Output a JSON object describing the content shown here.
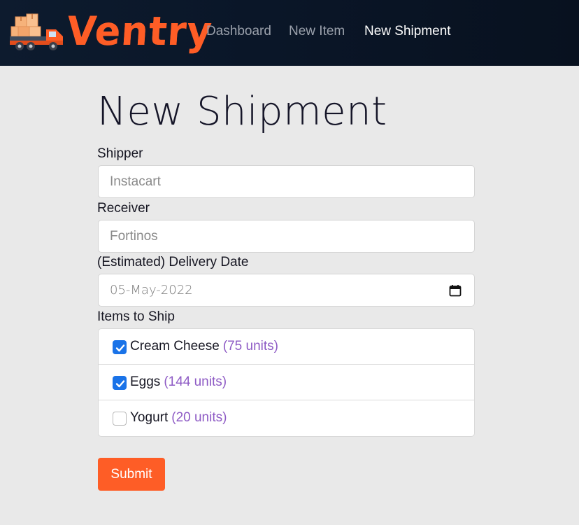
{
  "brand": {
    "name": "Ventry",
    "color": "#fe5d26"
  },
  "nav": {
    "items": [
      {
        "label": "Dashboard",
        "active": false
      },
      {
        "label": "New Item",
        "active": false
      },
      {
        "label": "New Shipment",
        "active": true
      }
    ]
  },
  "form": {
    "title": "New Shipment",
    "shipper": {
      "label": "Shipper",
      "placeholder": "Instacart"
    },
    "receiver": {
      "label": "Receiver",
      "placeholder": "Fortinos"
    },
    "delivery_date": {
      "label": "(Estimated) Delivery Date",
      "value": "05-May-2022",
      "icon": "calendar-icon"
    },
    "items_label": "Items to Ship",
    "items": [
      {
        "name": "Cream Cheese",
        "units": "(75 units)",
        "checked": true
      },
      {
        "name": "Eggs",
        "units": "(144 units)",
        "checked": true
      },
      {
        "name": "Yogurt",
        "units": "(20 units)",
        "checked": false
      }
    ],
    "submit_label": "Submit"
  },
  "colors": {
    "accent": "#fe5d26",
    "navbar": "#0a1628",
    "background": "#e9e9e9",
    "checkbox": "#1a73e8",
    "units": "#8e5bc5"
  }
}
